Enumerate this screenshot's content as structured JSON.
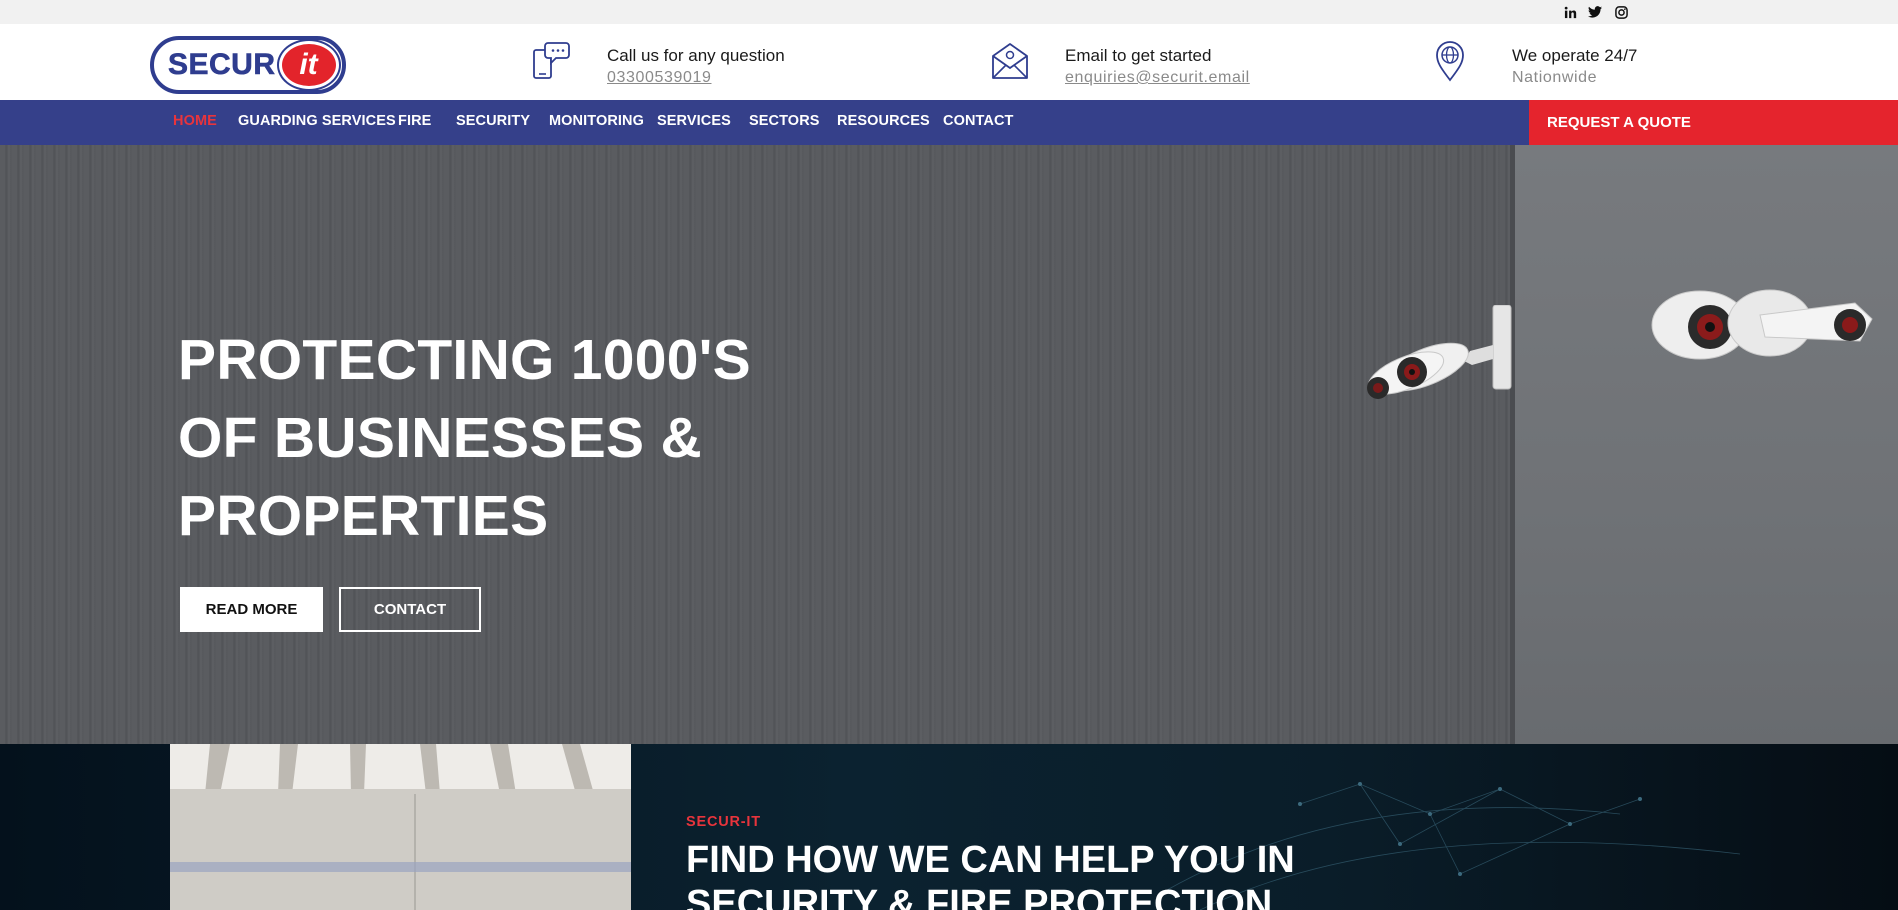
{
  "social": [
    {
      "name": "linkedin",
      "glyph": "in"
    },
    {
      "name": "twitter",
      "glyph": "t"
    },
    {
      "name": "instagram",
      "glyph": "ig"
    }
  ],
  "logo": {
    "part1": "SECUR",
    "part2": "it"
  },
  "header": {
    "phone": {
      "label": "Call us for any question",
      "value": "03300539019"
    },
    "email": {
      "label": "Email to get started",
      "value": "enquiries@securit.email"
    },
    "location": {
      "label": "We operate 24/7",
      "value": "Nationwide"
    }
  },
  "nav": {
    "items": [
      "HOME",
      "GUARDING SERVICES",
      "FIRE",
      "SECURITY",
      "MONITORING",
      "SERVICES",
      "SECTORS",
      "RESOURCES",
      "CONTACT"
    ],
    "active": "HOME",
    "quote_label": "REQUEST A QUOTE"
  },
  "hero": {
    "title_lines": [
      "PROTECTING 1000'S",
      "OF BUSINESSES &",
      "PROPERTIES"
    ],
    "read_more_label": "READ MORE",
    "contact_label": "CONTACT"
  },
  "section": {
    "kicker": "SECUR-IT",
    "title_lines": [
      "FIND HOW WE CAN HELP YOU IN",
      "SECURITY & FIRE PROTECTION"
    ]
  },
  "colors": {
    "brand_blue": "#35408a",
    "brand_red": "#e5242d"
  }
}
